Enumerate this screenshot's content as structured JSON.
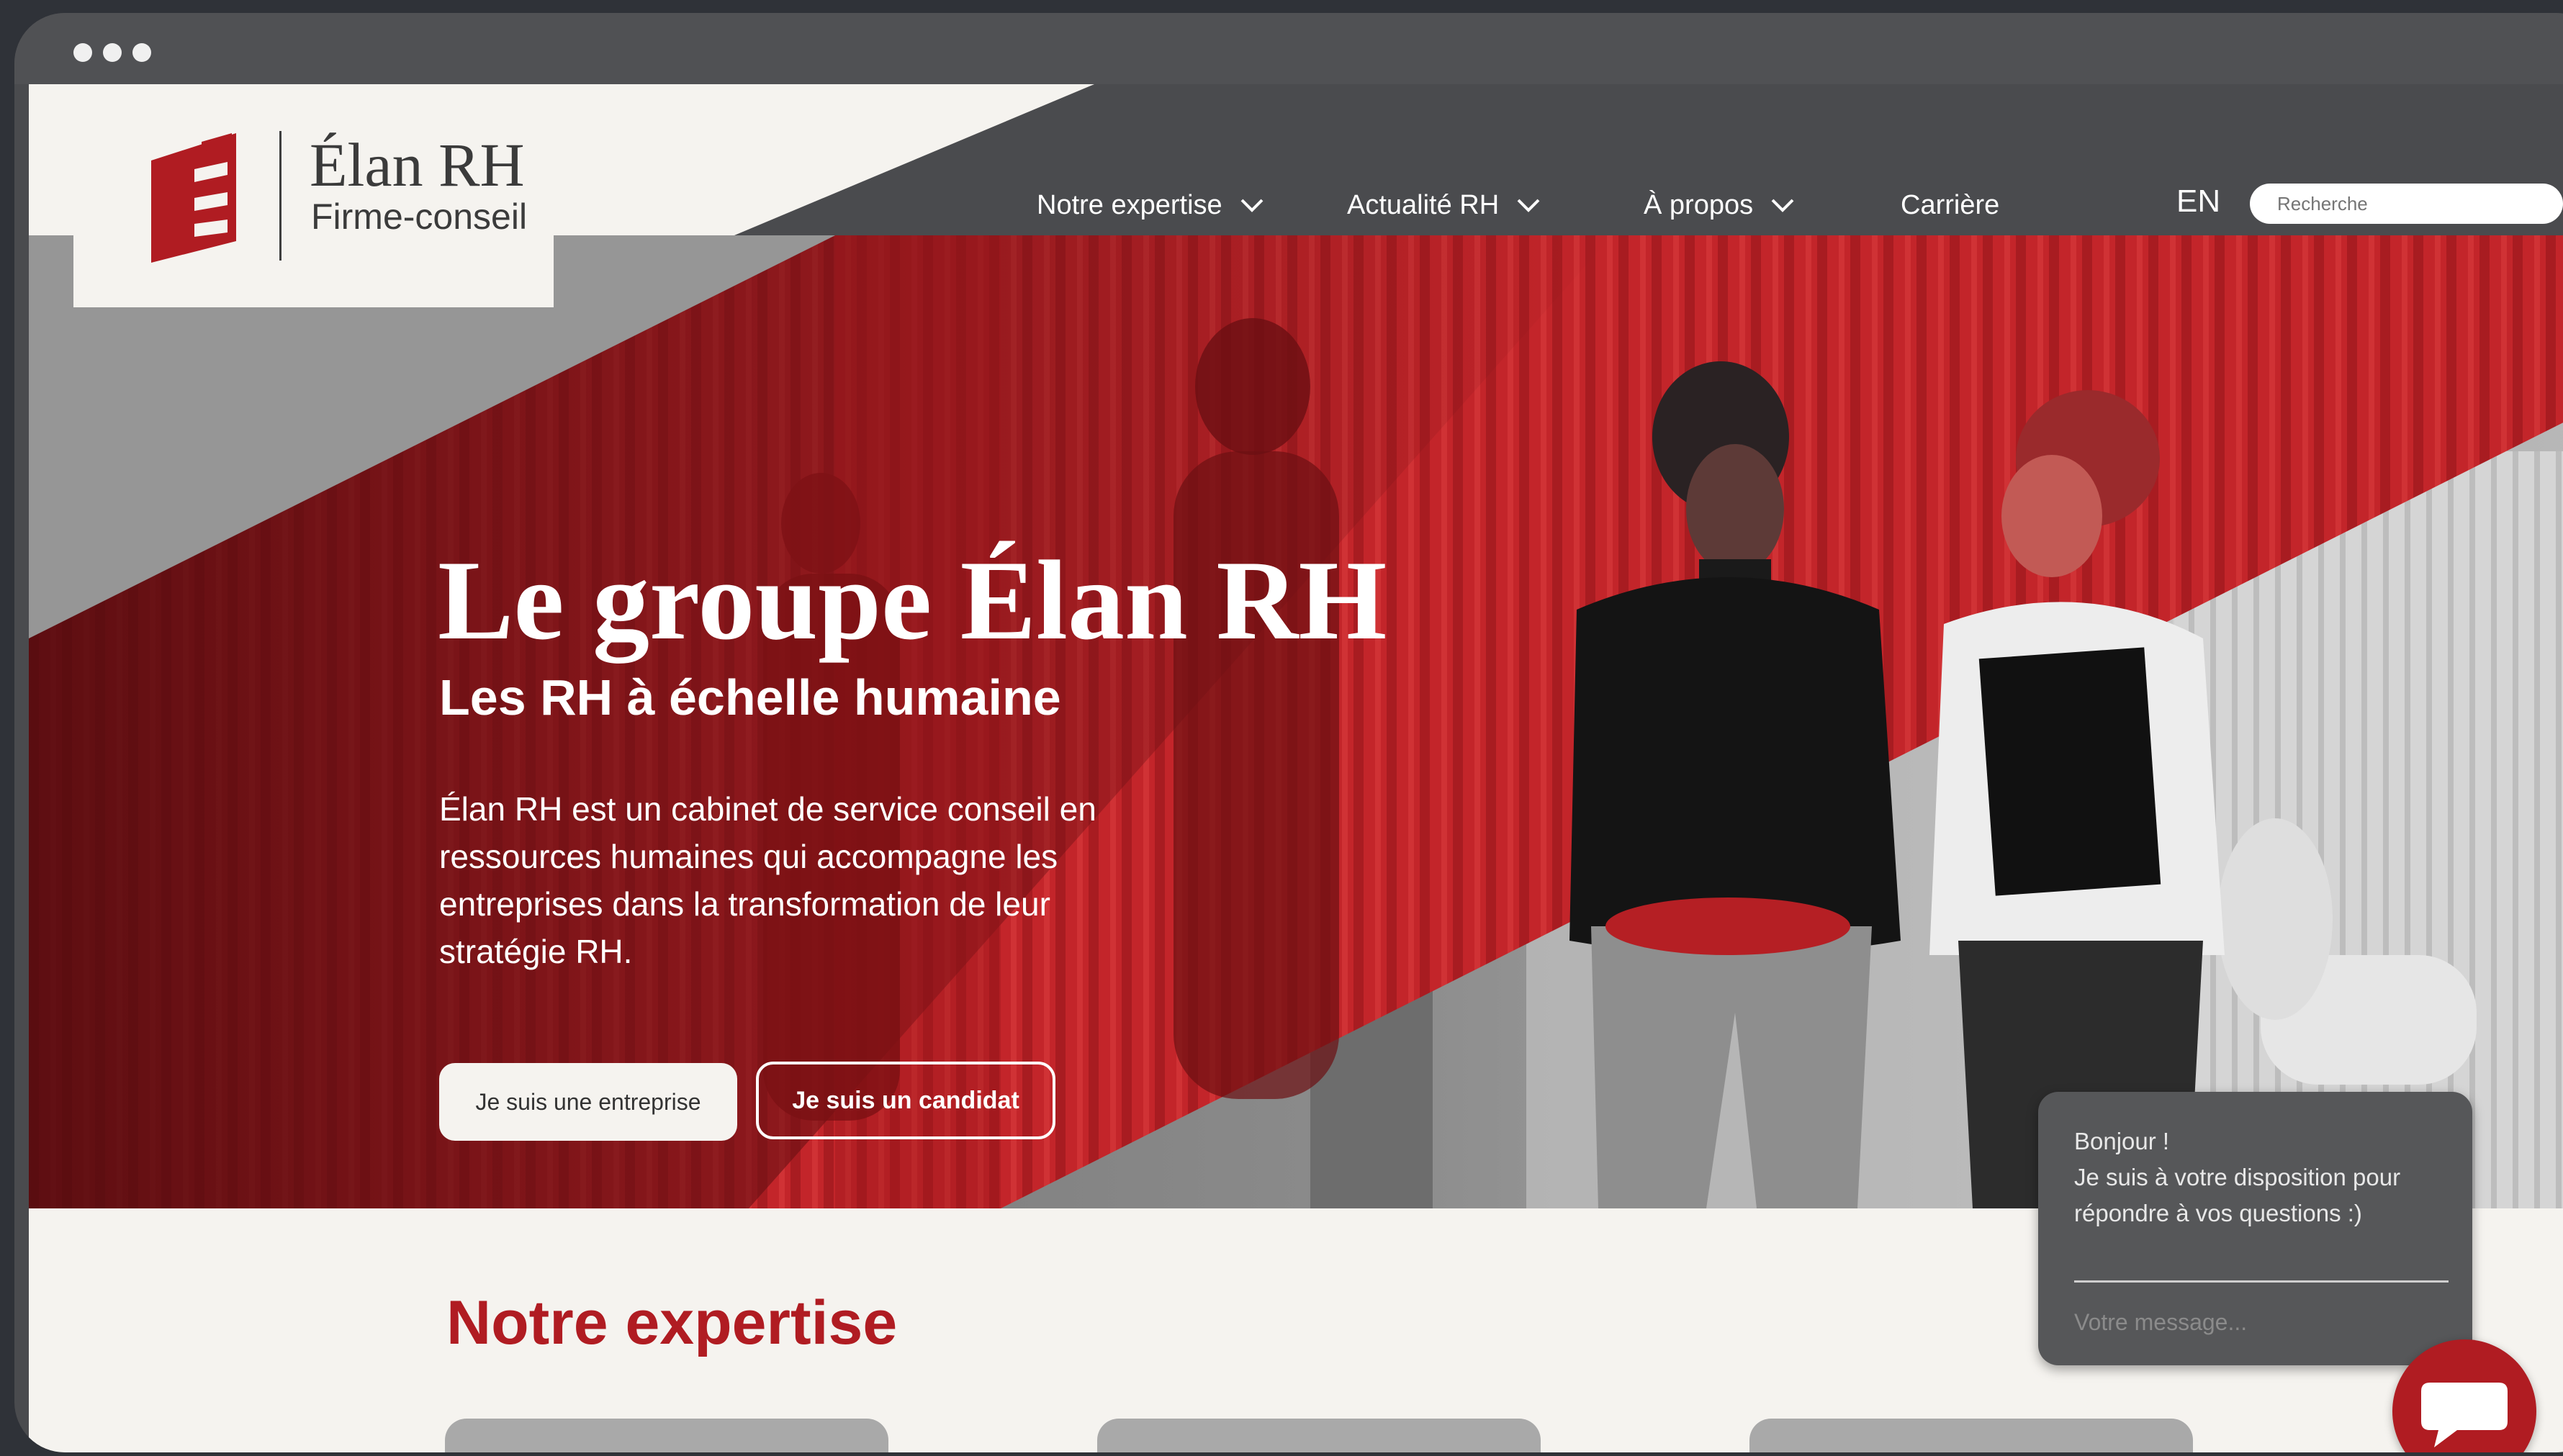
{
  "colors": {
    "brand_red": "#b01c22",
    "nav_gray": "#4a4b4e",
    "page_bg": "#f5f3ef"
  },
  "brand": {
    "name": "Élan RH",
    "tagline": "Firme-conseil"
  },
  "nav": {
    "items": [
      {
        "label": "Notre expertise",
        "icon": "chevron-down-icon"
      },
      {
        "label": "Actualité RH",
        "icon": "chevron-down-icon"
      },
      {
        "label": "À propos",
        "icon": "chevron-down-icon"
      },
      {
        "label": "Carrière"
      }
    ],
    "language": "EN",
    "search_placeholder": "Recherche"
  },
  "hero": {
    "title": "Le groupe Élan RH",
    "subtitle": "Les RH à échelle humaine",
    "description": "Élan RH est un cabinet de service conseil en ressources humaines qui accompagne les entreprises dans la transformation de leur stratégie RH.",
    "buttons": {
      "company": "Je suis une entreprise",
      "candidate": "Je suis un candidat"
    }
  },
  "section": {
    "title": "Notre expertise"
  },
  "chat": {
    "greeting": "Bonjour !\nJe suis à votre disposition pour répondre à vos questions   :)",
    "input_placeholder": "Votre message...",
    "button_icon": "chat-bubble-icon"
  }
}
